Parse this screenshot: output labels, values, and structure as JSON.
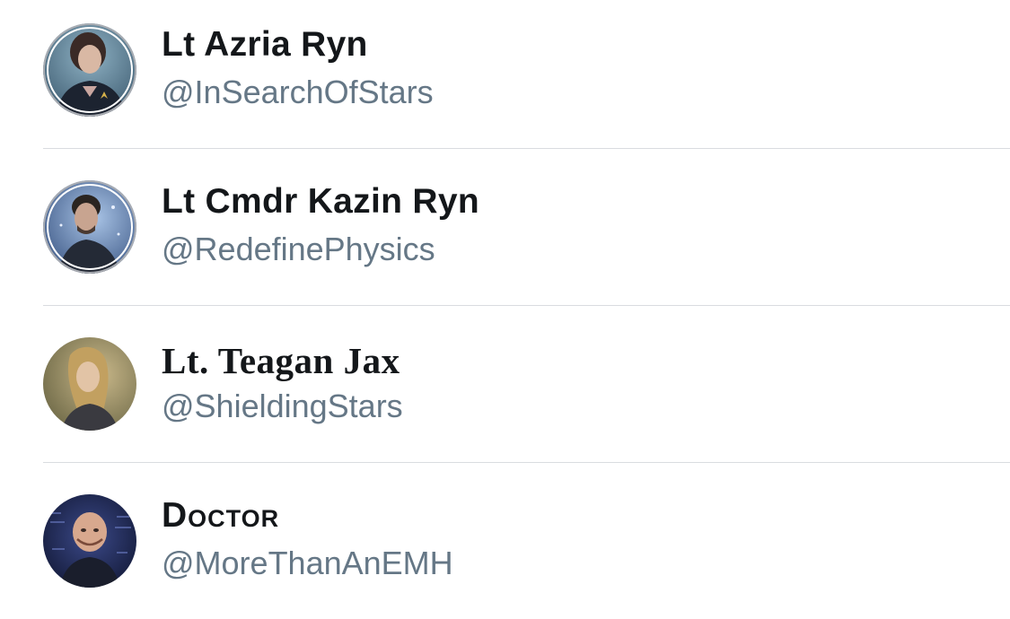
{
  "accounts": [
    {
      "name": "Lt Azria Ryn",
      "handle": "@InSearchOfStars",
      "avatar": "avatar-photo"
    },
    {
      "name": "Lt Cmdr Kazin Ryn",
      "handle": "@RedefinePhysics",
      "avatar": "avatar-photo"
    },
    {
      "name": "Lt. Teagan Jax",
      "handle": "@ShieldingStars",
      "avatar": "avatar-photo"
    },
    {
      "name": "Doctor",
      "handle": "@MoreThanAnEMH",
      "avatar": "avatar-photo"
    }
  ],
  "colors": {
    "name_text": "#14171a",
    "handle_text": "#657786",
    "divider": "#d9dce0",
    "background": "#ffffff"
  }
}
